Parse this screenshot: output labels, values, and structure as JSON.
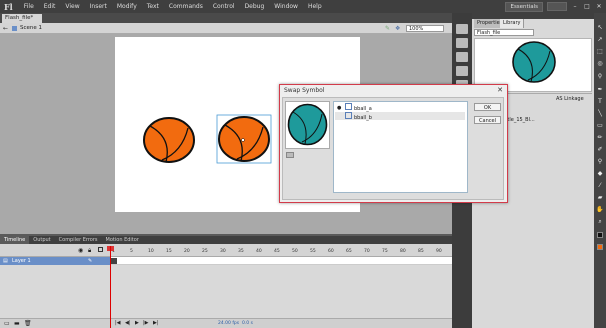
{
  "app": {
    "logo": "Fl"
  },
  "menu": [
    "File",
    "Edit",
    "View",
    "Insert",
    "Modify",
    "Text",
    "Commands",
    "Control",
    "Debug",
    "Window",
    "Help"
  ],
  "workspace": "Essentials",
  "document": {
    "tab": "Flash_file*"
  },
  "editbar": {
    "scene": "Scene 1",
    "zoom": "100%"
  },
  "panel": {
    "tabs": [
      "Properties",
      "Library"
    ],
    "library_select": "Flash_file",
    "linkage": "AS Linkage",
    "item": "Series_Turtle_15_Bl..."
  },
  "dialog": {
    "title": "Swap Symbol",
    "symbols": [
      "bball_a",
      "bball_b"
    ],
    "selected_index": 1,
    "ok": "OK",
    "cancel": "Cancel"
  },
  "timeline": {
    "tabs": [
      "Timeline",
      "Output",
      "Compiler Errors",
      "Motion Editor"
    ],
    "layer": "Layer 1",
    "frame_numbers": [
      "1",
      "5",
      "10",
      "15",
      "20",
      "25",
      "30",
      "35",
      "40",
      "45",
      "50",
      "55",
      "60",
      "65",
      "70",
      "75",
      "80",
      "85",
      "90"
    ],
    "fps": "24.00 fps",
    "time": "0.0 s"
  },
  "colors": {
    "ball_orange": "#f26b0f",
    "ball_teal": "#1e9a9b",
    "accent": "#d23b4a"
  }
}
